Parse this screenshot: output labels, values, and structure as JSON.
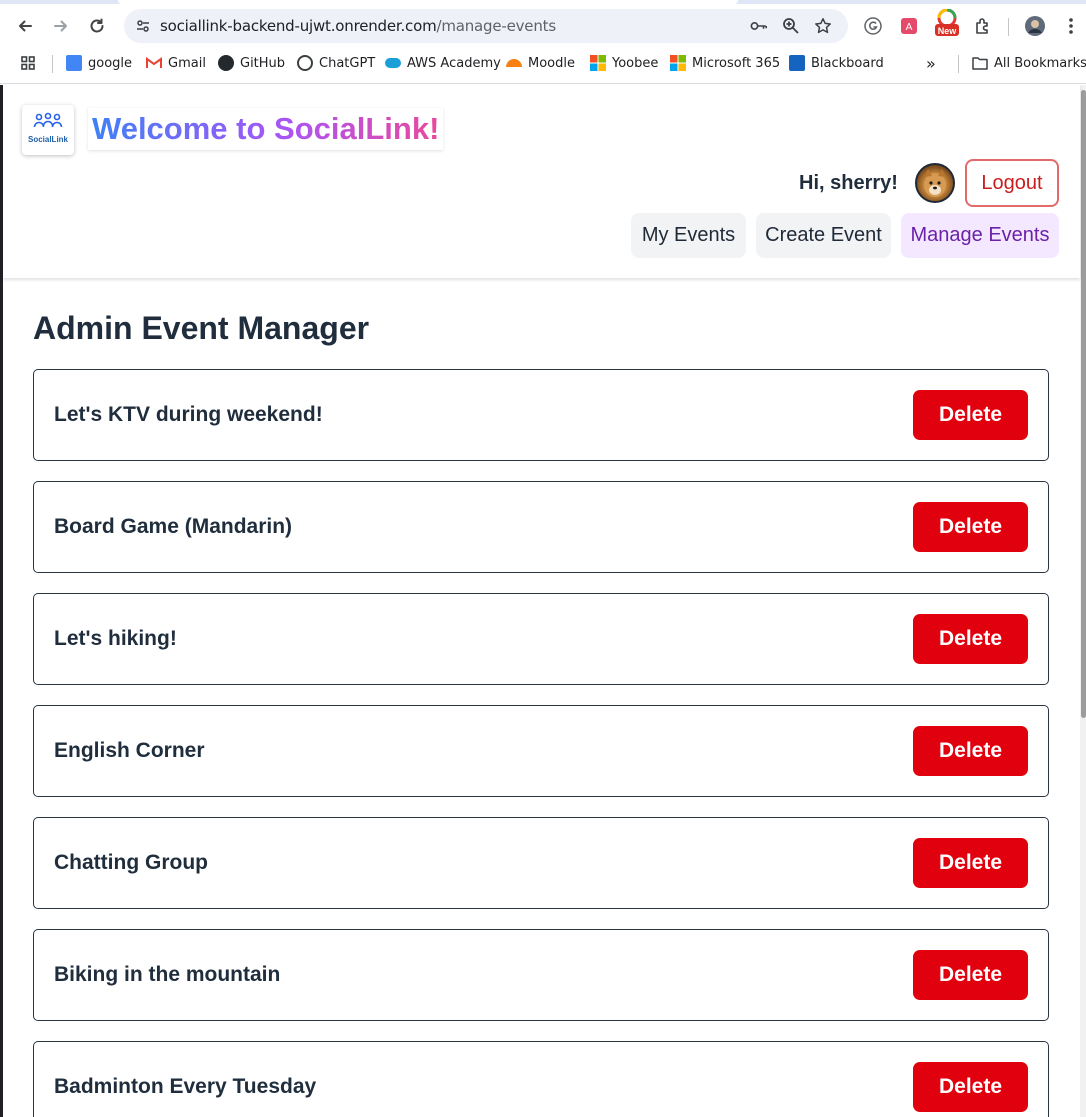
{
  "browser": {
    "url_host": "sociallink-backend-ujwt.onrender.com",
    "url_path": "/manage-events",
    "ext_new_badge": "New",
    "bookmarks": [
      {
        "label": "google",
        "color": "#4285f4"
      },
      {
        "label": "Gmail",
        "color": "#ea4335"
      },
      {
        "label": "GitHub",
        "color": "#24292e"
      },
      {
        "label": "ChatGPT",
        "color": "#3c4043"
      },
      {
        "label": "AWS Academy",
        "color": "#1a9fd9"
      },
      {
        "label": "Moodle",
        "color": "#f98012"
      },
      {
        "label": "Yoobee",
        "color": "#f25022"
      },
      {
        "label": "Microsoft 365",
        "color": "#f25022"
      },
      {
        "label": "Blackboard",
        "color": "#1565c0"
      }
    ],
    "all_bookmarks": "All Bookmarks"
  },
  "header": {
    "logo_text": "SocialLink",
    "welcome": "Welcome to SocialLink!",
    "greeting": "Hi, sherry!",
    "logout_label": "Logout",
    "nav": {
      "my_events": "My Events",
      "create_event": "Create Event",
      "manage_events": "Manage Events"
    }
  },
  "main": {
    "title": "Admin Event Manager",
    "delete_label": "Delete",
    "events": [
      "Let's KTV during weekend!",
      "Board Game (Mandarin)",
      "Let's hiking!",
      "English Corner",
      "Chatting Group",
      "Biking in the mountain",
      "Badminton Every Tuesday"
    ]
  },
  "colors": {
    "delete": "#e0000e",
    "active_nav_bg": "#f3e8ff",
    "active_nav_text": "#6b21a8",
    "logout_border": "#e26a6a"
  }
}
